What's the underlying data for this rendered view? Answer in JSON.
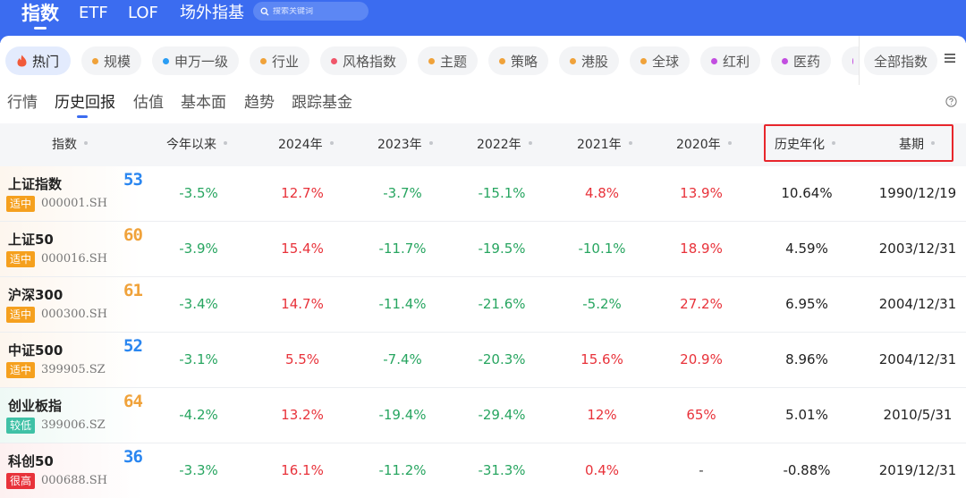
{
  "top_nav": [
    {
      "label": "指数",
      "active": true
    },
    {
      "label": "ETF",
      "active": false
    },
    {
      "label": "LOF",
      "active": false
    },
    {
      "label": "场外指基",
      "active": false
    }
  ],
  "search": {
    "placeholder": "搜索关键词",
    "icon": "search-icon"
  },
  "chips": [
    {
      "label": "热门",
      "active": true,
      "icon": "flame-icon",
      "color": "#f15a3a"
    },
    {
      "label": "规模",
      "color": "#f0a23a"
    },
    {
      "label": "申万一级",
      "color": "#2a9df4"
    },
    {
      "label": "行业",
      "color": "#f0a23a"
    },
    {
      "label": "风格指数",
      "color": "#f0566a"
    },
    {
      "label": "主题",
      "color": "#f0a23a"
    },
    {
      "label": "策略",
      "color": "#f0a23a"
    },
    {
      "label": "港股",
      "color": "#f0a23a"
    },
    {
      "label": "全球",
      "color": "#f0a23a"
    },
    {
      "label": "红利",
      "color": "#c24ee0"
    },
    {
      "label": "医药",
      "color": "#c24ee0"
    },
    {
      "label": "",
      "color": "#c24ee0"
    },
    {
      "label": "全部指数",
      "color": ""
    }
  ],
  "sub_tabs": [
    {
      "label": "行情",
      "active": false
    },
    {
      "label": "历史回报",
      "active": true
    },
    {
      "label": "估值",
      "active": false
    },
    {
      "label": "基本面",
      "active": false
    },
    {
      "label": "趋势",
      "active": false
    },
    {
      "label": "跟踪基金",
      "active": false
    }
  ],
  "columns": [
    "指数",
    "今年以来",
    "2024年",
    "2023年",
    "2022年",
    "2021年",
    "2020年",
    "历史年化",
    "基期"
  ],
  "rows": [
    {
      "name": "上证指数",
      "badge": "适中",
      "badge_color": "#f5a01e",
      "code": "000001.SH",
      "score": "53",
      "score_color": "#2a86f0",
      "bg": "#fdf6ee",
      "cells": [
        {
          "v": "-3.5%",
          "c": "down"
        },
        {
          "v": "12.7%",
          "c": "up"
        },
        {
          "v": "-3.7%",
          "c": "down"
        },
        {
          "v": "-15.1%",
          "c": "down"
        },
        {
          "v": "4.8%",
          "c": "up"
        },
        {
          "v": "13.9%",
          "c": "up"
        },
        {
          "v": "10.64%",
          "c": "plain"
        },
        {
          "v": "1990/12/19",
          "c": "plain"
        }
      ]
    },
    {
      "name": "上证50",
      "badge": "适中",
      "badge_color": "#f5a01e",
      "code": "000016.SH",
      "score": "60",
      "score_color": "#f0a23a",
      "bg": "#fdf6ee",
      "cells": [
        {
          "v": "-3.9%",
          "c": "down"
        },
        {
          "v": "15.4%",
          "c": "up"
        },
        {
          "v": "-11.7%",
          "c": "down"
        },
        {
          "v": "-19.5%",
          "c": "down"
        },
        {
          "v": "-10.1%",
          "c": "down"
        },
        {
          "v": "18.9%",
          "c": "up"
        },
        {
          "v": "4.59%",
          "c": "plain"
        },
        {
          "v": "2003/12/31",
          "c": "plain"
        }
      ]
    },
    {
      "name": "沪深300",
      "badge": "适中",
      "badge_color": "#f5a01e",
      "code": "000300.SH",
      "score": "61",
      "score_color": "#f0a23a",
      "bg": "#fdf6ee",
      "cells": [
        {
          "v": "-3.4%",
          "c": "down"
        },
        {
          "v": "14.7%",
          "c": "up"
        },
        {
          "v": "-11.4%",
          "c": "down"
        },
        {
          "v": "-21.6%",
          "c": "down"
        },
        {
          "v": "-5.2%",
          "c": "down"
        },
        {
          "v": "27.2%",
          "c": "up"
        },
        {
          "v": "6.95%",
          "c": "plain"
        },
        {
          "v": "2004/12/31",
          "c": "plain"
        }
      ]
    },
    {
      "name": "中证500",
      "badge": "适中",
      "badge_color": "#f5a01e",
      "code": "399905.SZ",
      "score": "52",
      "score_color": "#2a86f0",
      "bg": "#fdf6ee",
      "cells": [
        {
          "v": "-3.1%",
          "c": "down"
        },
        {
          "v": "5.5%",
          "c": "up"
        },
        {
          "v": "-7.4%",
          "c": "down"
        },
        {
          "v": "-20.3%",
          "c": "down"
        },
        {
          "v": "15.6%",
          "c": "up"
        },
        {
          "v": "20.9%",
          "c": "up"
        },
        {
          "v": "8.96%",
          "c": "plain"
        },
        {
          "v": "2004/12/31",
          "c": "plain"
        }
      ]
    },
    {
      "name": "创业板指",
      "badge": "较低",
      "badge_color": "#3fc1a6",
      "code": "399006.SZ",
      "score": "64",
      "score_color": "#f0a23a",
      "bg": "#eef9f5",
      "cells": [
        {
          "v": "-4.2%",
          "c": "down"
        },
        {
          "v": "13.2%",
          "c": "up"
        },
        {
          "v": "-19.4%",
          "c": "down"
        },
        {
          "v": "-29.4%",
          "c": "down"
        },
        {
          "v": "12%",
          "c": "up"
        },
        {
          "v": "65%",
          "c": "up"
        },
        {
          "v": "5.01%",
          "c": "plain"
        },
        {
          "v": "2010/5/31",
          "c": "plain"
        }
      ]
    },
    {
      "name": "科创50",
      "badge": "很高",
      "badge_color": "#e8323a",
      "code": "000688.SH",
      "score": "36",
      "score_color": "#2a86f0",
      "bg": "#fdf0f0",
      "cells": [
        {
          "v": "-3.3%",
          "c": "down"
        },
        {
          "v": "16.1%",
          "c": "up"
        },
        {
          "v": "-11.2%",
          "c": "down"
        },
        {
          "v": "-31.3%",
          "c": "down"
        },
        {
          "v": "0.4%",
          "c": "up"
        },
        {
          "v": "-",
          "c": "flat"
        },
        {
          "v": "-0.88%",
          "c": "plain"
        },
        {
          "v": "2019/12/31",
          "c": "plain"
        }
      ]
    }
  ]
}
